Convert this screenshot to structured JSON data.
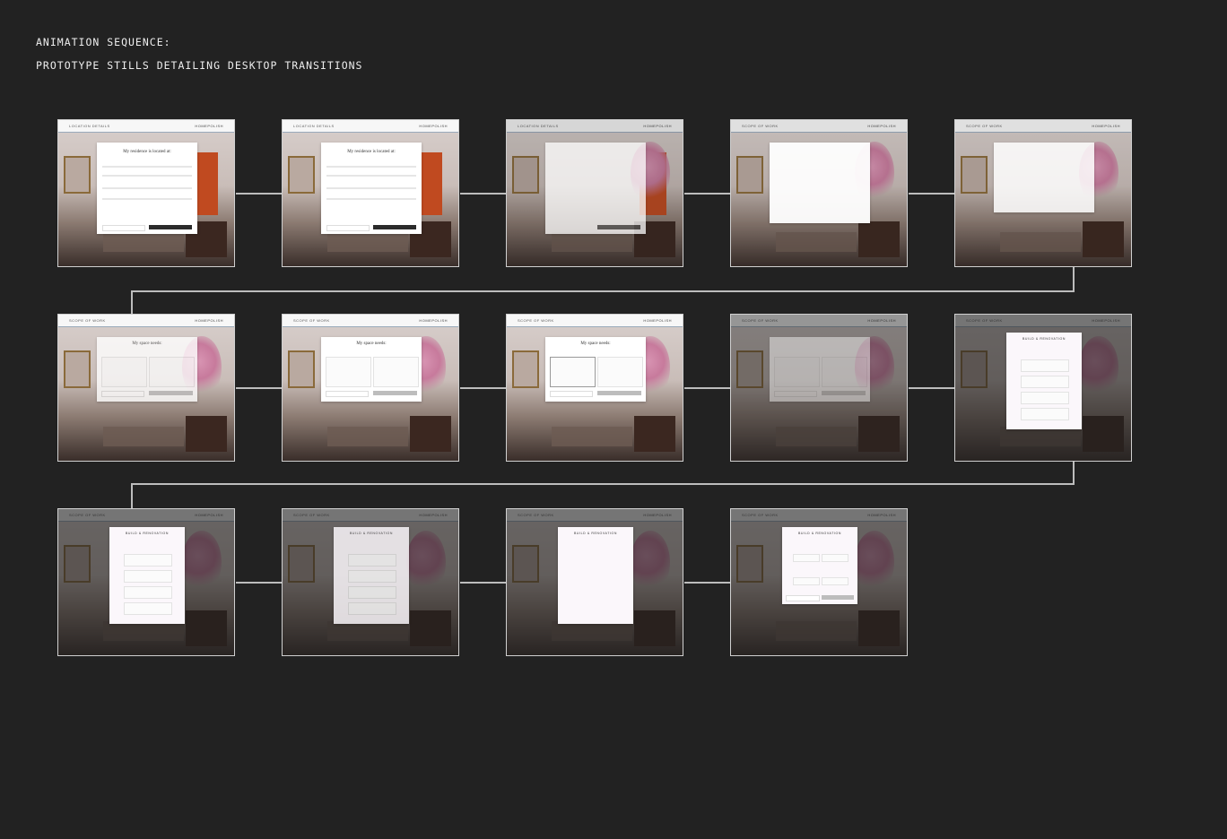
{
  "header": {
    "line1": "ANIMATION SEQUENCE:",
    "line2": "PROTOTYPE STILLS DETAILING DESKTOP TRANSITIONS"
  },
  "frames": [
    {
      "section": "LOCATION DETAILS",
      "brand": "HOMEPOLISH",
      "modal_title": "My residence is located at:",
      "state": "address-form"
    },
    {
      "section": "LOCATION DETAILS",
      "brand": "HOMEPOLISH",
      "modal_title": "My residence is located at:",
      "state": "address-form"
    },
    {
      "section": "LOCATION DETAILS",
      "brand": "HOMEPOLISH",
      "modal_title": "",
      "state": "fade-out"
    },
    {
      "section": "SCOPE OF WORK",
      "brand": "HOMEPOLISH",
      "modal_title": "",
      "state": "blank"
    },
    {
      "section": "SCOPE OF WORK",
      "brand": "HOMEPOLISH",
      "modal_title": "",
      "state": "fade-in"
    },
    {
      "section": "SCOPE OF WORK",
      "brand": "HOMEPOLISH",
      "modal_title": "My space needs:",
      "state": "scope-cards-faint"
    },
    {
      "section": "SCOPE OF WORK",
      "brand": "HOMEPOLISH",
      "modal_title": "My space needs:",
      "state": "scope-cards"
    },
    {
      "section": "SCOPE OF WORK",
      "brand": "HOMEPOLISH",
      "modal_title": "My space needs:",
      "state": "scope-cards-selected"
    },
    {
      "section": "SCOPE OF WORK",
      "brand": "HOMEPOLISH",
      "modal_title": "",
      "state": "dim-fade"
    },
    {
      "section": "SCOPE OF WORK",
      "brand": "HOMEPOLISH",
      "modal_title": "BUILD & RENOVATION",
      "state": "reno-options"
    },
    {
      "section": "SCOPE OF WORK",
      "brand": "HOMEPOLISH",
      "modal_title": "BUILD & RENOVATION",
      "state": "reno-options"
    },
    {
      "section": "SCOPE OF WORK",
      "brand": "HOMEPOLISH",
      "modal_title": "BUILD & RENOVATION",
      "state": "reno-options-faint"
    },
    {
      "section": "SCOPE OF WORK",
      "brand": "HOMEPOLISH",
      "modal_title": "BUILD & RENOVATION",
      "state": "reno-blank"
    },
    {
      "section": "SCOPE OF WORK",
      "brand": "HOMEPOLISH",
      "modal_title": "BUILD & RENOVATION",
      "state": "reno-questions"
    }
  ],
  "colors": {
    "background": "#222222",
    "frame_border": "#d0d0d0",
    "connector": "#bdbdbd"
  }
}
